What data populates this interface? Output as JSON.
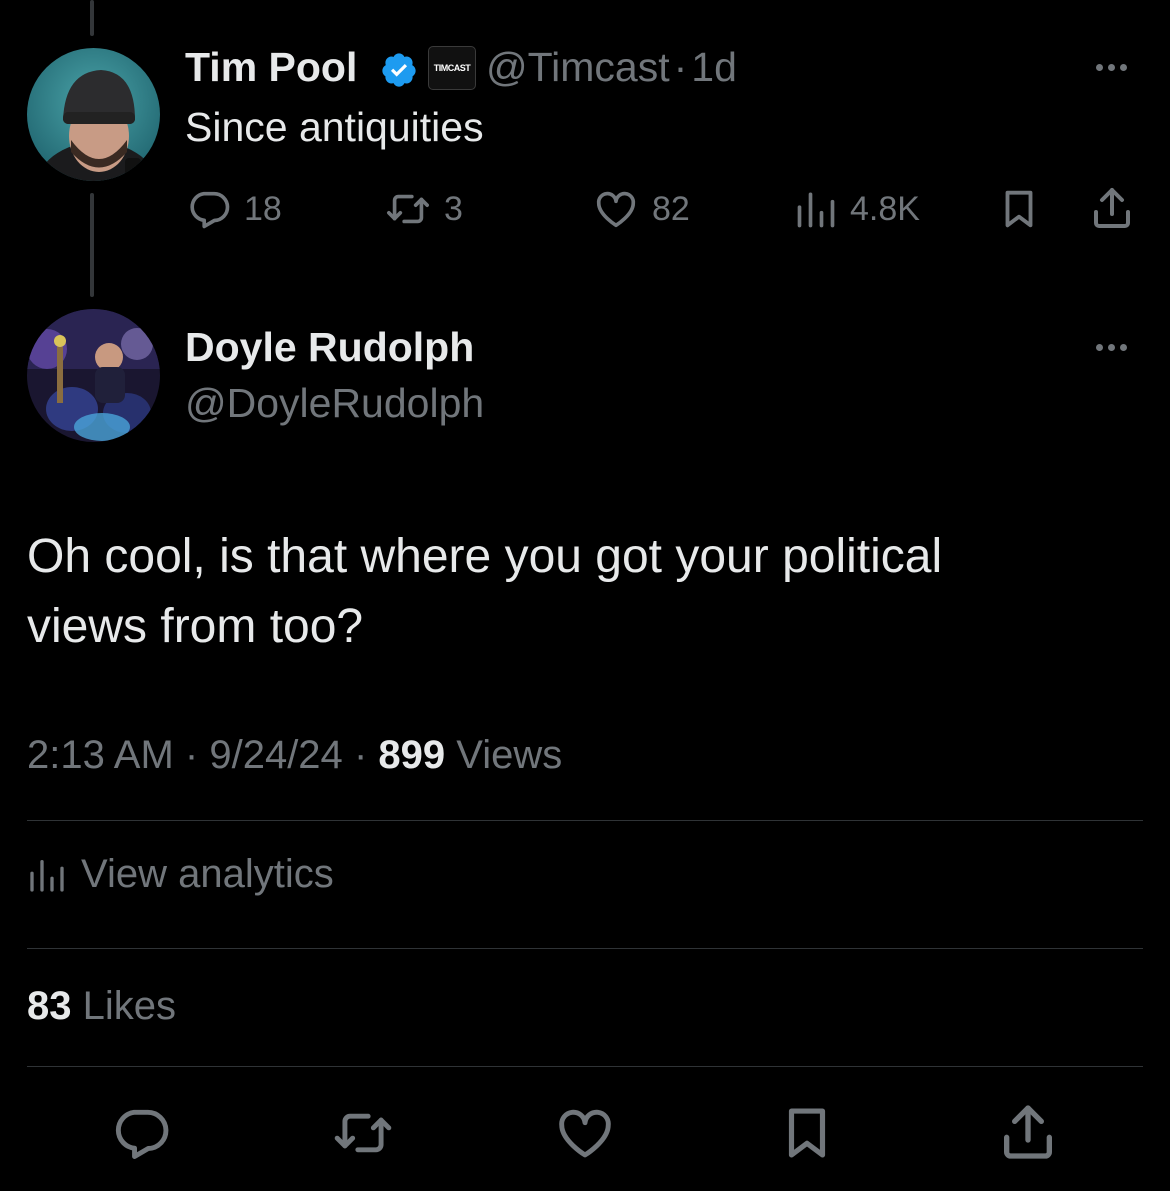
{
  "parent_tweet": {
    "display_name": "Tim Pool",
    "affiliate_badge": "TIMCAST",
    "handle": "@Timcast",
    "separator": "·",
    "time_ago": "1d",
    "text": "Since antiquities",
    "actions": {
      "replies": "18",
      "retweets": "3",
      "likes": "82",
      "views": "4.8K"
    },
    "icons": [
      "verified-badge-icon",
      "reply-icon",
      "retweet-icon",
      "like-icon",
      "views-icon",
      "bookmark-icon",
      "share-icon",
      "more-icon"
    ]
  },
  "reply_tweet": {
    "display_name": "Doyle Rudolph",
    "handle": "@DoyleRudolph",
    "text_line1": "Oh cool, is that where you got your political",
    "text_line2": "views from too?",
    "time": "2:13 AM",
    "date": "9/24/24",
    "separator": "·",
    "views_count": "899",
    "views_label": "Views",
    "analytics_label": "View analytics",
    "likes_count": "83",
    "likes_label": "Likes"
  },
  "colors": {
    "background": "#000000",
    "text_primary": "#e7e9ea",
    "text_secondary": "#71767b",
    "verified_blue": "#1d9bf0",
    "divider": "#2f3336"
  }
}
